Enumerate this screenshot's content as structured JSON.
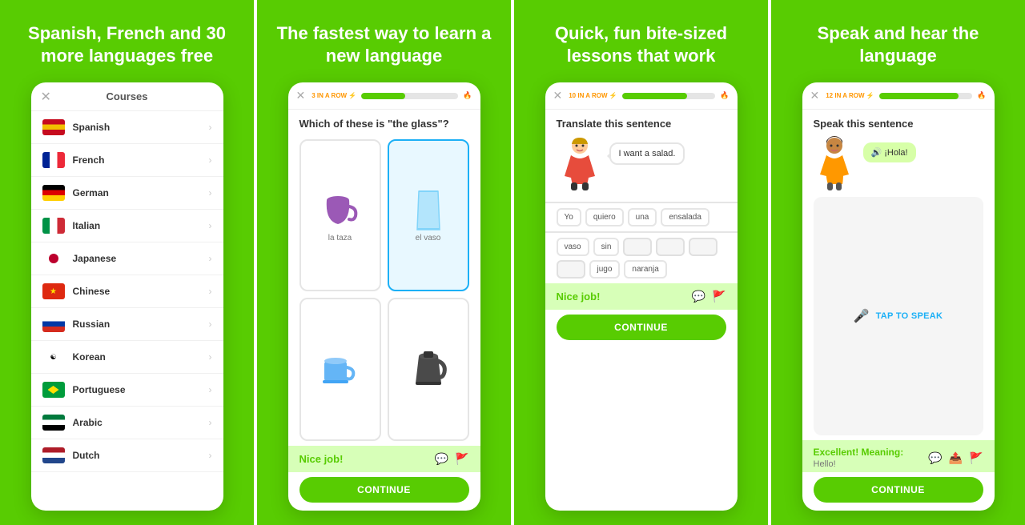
{
  "panels": [
    {
      "id": "panel1",
      "title": "Spanish, French and 30 more languages free",
      "phone": {
        "header": "Courses",
        "courses": [
          {
            "name": "Spanish",
            "flag": "es"
          },
          {
            "name": "French",
            "flag": "fr"
          },
          {
            "name": "German",
            "flag": "de"
          },
          {
            "name": "Italian",
            "flag": "it"
          },
          {
            "name": "Japanese",
            "flag": "jp"
          },
          {
            "name": "Chinese",
            "flag": "cn"
          },
          {
            "name": "Russian",
            "flag": "ru"
          },
          {
            "name": "Korean",
            "flag": "kr"
          },
          {
            "name": "Portuguese",
            "flag": "br"
          },
          {
            "name": "Arabic",
            "flag": "ar"
          },
          {
            "name": "Dutch",
            "flag": "nl"
          }
        ]
      }
    },
    {
      "id": "panel2",
      "title": "The fastest way to learn a new language",
      "phone": {
        "streak": "3 IN A ROW",
        "progress": 45,
        "question": "Which of these is \"the glass\"?",
        "options": [
          {
            "label": "la taza",
            "selected": false
          },
          {
            "label": "el vaso",
            "selected": true
          },
          {
            "label": "",
            "selected": false
          },
          {
            "label": "",
            "selected": false
          }
        ],
        "nice_job": "Nice job!",
        "continue": "CONTINUE"
      }
    },
    {
      "id": "panel3",
      "title": "Quick, fun bite-sized lessons that work",
      "phone": {
        "streak": "10 IN A ROW",
        "progress": 70,
        "title": "Translate this sentence",
        "speech": "I want a salad.",
        "answer_chips": [
          "Yo",
          "quiero",
          "una",
          "ensalada"
        ],
        "word_bank": [
          "vaso",
          "sin",
          "",
          "",
          "",
          "jugo",
          "naranja"
        ],
        "nice_job": "Nice job!",
        "continue": "CONTINUE"
      }
    },
    {
      "id": "panel4",
      "title": "Speak and hear the language",
      "phone": {
        "streak": "12 IN A ROW",
        "progress": 85,
        "title": "Speak this sentence",
        "speech_bubble": "¡Hola!",
        "tap_speak": "TAP TO SPEAK",
        "excellent": "Excellent! Meaning:",
        "meaning": "Hello!",
        "continue": "CONTINUE"
      }
    }
  ]
}
